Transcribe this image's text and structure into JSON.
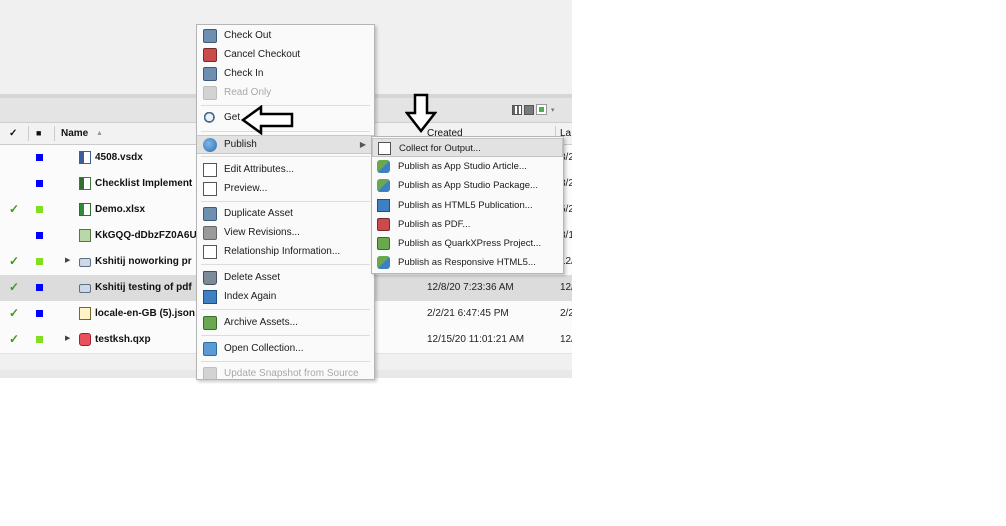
{
  "colors": {
    "check_green": "#3a9a1a",
    "status_blue": "#0000ff",
    "status_lime": "#80e020",
    "selected_row": "#dcdcdc",
    "menu_highlight": "#e2e2e2"
  },
  "table": {
    "headers": {
      "check_col": "✓",
      "flag_col": "■",
      "name": "Name",
      "name_sort": "▲",
      "created": "Created",
      "last": "La"
    },
    "rows": [
      {
        "check": "",
        "status_color": "#0000ff",
        "expand": "",
        "icon": "visio-file-icon",
        "name": "4508.vsdx",
        "created": "",
        "last": "3/2"
      },
      {
        "check": "",
        "status_color": "#0000ff",
        "expand": "",
        "icon": "document-file-icon",
        "name": "Checklist Implement",
        "created": "",
        "last": "3/2"
      },
      {
        "check": "✓",
        "status_color": "#80e020",
        "expand": "",
        "icon": "excel-file-icon",
        "name": "Demo.xlsx",
        "created": "",
        "last": "5/2"
      },
      {
        "check": "",
        "status_color": "#0000ff",
        "expand": "",
        "icon": "image-file-icon",
        "name": "KkGQQ-dDbzFZ0A6U",
        "created": "",
        "last": "3/1"
      },
      {
        "check": "✓",
        "status_color": "#80e020",
        "expand": "▶",
        "icon": "project-file-icon",
        "name": "Kshitij noworking pr",
        "created": "",
        "last": "12/"
      },
      {
        "check": "✓",
        "status_color": "#0000ff",
        "expand": "",
        "icon": "project-file-icon",
        "name": "Kshitij testing of pdf",
        "created": "12/8/20 7:23:36 AM",
        "last": "12/"
      },
      {
        "check": "✓",
        "status_color": "#0000ff",
        "expand": "",
        "icon": "json-file-icon",
        "name": "locale-en-GB (5).json",
        "created": "2/2/21 6:47:45 PM",
        "last": "2/2"
      },
      {
        "check": "✓",
        "status_color": "#80e020",
        "expand": "▶",
        "icon": "quark-file-icon",
        "name": "testksh.qxp",
        "created": "12/15/20 11:01:21 AM",
        "last": "12/"
      }
    ]
  },
  "context_menu": {
    "items": [
      {
        "label": "Check Out",
        "icon": "check-out-icon",
        "disabled": false
      },
      {
        "label": "Cancel Checkout",
        "icon": "cancel-checkout-icon",
        "disabled": false
      },
      {
        "label": "Check In",
        "icon": "check-in-icon",
        "disabled": false
      },
      {
        "label": "Read Only",
        "icon": "read-only-icon",
        "disabled": true
      },
      {
        "label": "Get",
        "icon": "get-icon",
        "disabled": false
      },
      {
        "label": "Publish",
        "icon": "publish-icon",
        "disabled": false,
        "submenu_arrow": "▶"
      },
      {
        "label": "Edit Attributes...",
        "icon": "edit-attributes-icon",
        "disabled": false
      },
      {
        "label": "Preview...",
        "icon": "preview-icon",
        "disabled": false
      },
      {
        "label": "Duplicate Asset",
        "icon": "duplicate-icon",
        "disabled": false
      },
      {
        "label": "View Revisions...",
        "icon": "revisions-icon",
        "disabled": false
      },
      {
        "label": "Relationship Information...",
        "icon": "relationship-icon",
        "disabled": false
      },
      {
        "label": "Delete Asset",
        "icon": "trash-icon",
        "disabled": false
      },
      {
        "label": "Index Again",
        "icon": "index-icon",
        "disabled": false
      },
      {
        "label": "Archive Assets...",
        "icon": "archive-icon",
        "disabled": false
      },
      {
        "label": "Open Collection...",
        "icon": "collection-icon",
        "disabled": false
      },
      {
        "label": "Update Snapshot from Source",
        "icon": "snapshot-icon",
        "disabled": true
      }
    ]
  },
  "publish_submenu": {
    "items": [
      {
        "label": "Collect for Output...",
        "icon": "collect-output-icon"
      },
      {
        "label": "Publish as App Studio Article...",
        "icon": "app-studio-article-icon"
      },
      {
        "label": "Publish as App Studio Package...",
        "icon": "app-studio-package-icon"
      },
      {
        "label": "Publish as HTML5 Publication...",
        "icon": "html5-publication-icon"
      },
      {
        "label": "Publish as PDF...",
        "icon": "pdf-icon"
      },
      {
        "label": "Publish as QuarkXPress Project...",
        "icon": "quarkxpress-icon"
      },
      {
        "label": "Publish as Responsive HTML5...",
        "icon": "responsive-html5-icon"
      }
    ]
  },
  "annotations": {
    "left_arrow": "arrow-pointing-left-to-get",
    "down_arrow": "arrow-pointing-down-to-collect"
  }
}
